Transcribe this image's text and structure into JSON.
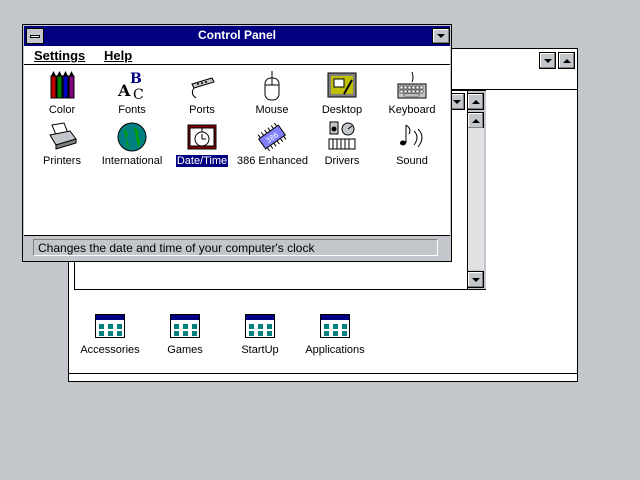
{
  "control_panel": {
    "title": "Control Panel",
    "menu": [
      {
        "label": "Settings"
      },
      {
        "label": "Help"
      }
    ],
    "icons": [
      {
        "label": "Color",
        "icon": "color-icon"
      },
      {
        "label": "Fonts",
        "icon": "fonts-icon"
      },
      {
        "label": "Ports",
        "icon": "ports-icon"
      },
      {
        "label": "Mouse",
        "icon": "mouse-icon"
      },
      {
        "label": "Desktop",
        "icon": "desktop-icon"
      },
      {
        "label": "Keyboard",
        "icon": "keyboard-icon"
      },
      {
        "label": "Printers",
        "icon": "printers-icon"
      },
      {
        "label": "International",
        "icon": "globe-icon"
      },
      {
        "label": "Date/Time",
        "icon": "date-time-icon",
        "selected": true
      },
      {
        "label": "386 Enhanced",
        "icon": "chip-icon"
      },
      {
        "label": "Drivers",
        "icon": "drivers-icon"
      },
      {
        "label": "Sound",
        "icon": "sound-icon"
      }
    ],
    "status": "Changes the date and time of your computer's clock"
  },
  "program_manager": {
    "groups": [
      {
        "label": "Accessories"
      },
      {
        "label": "Games"
      },
      {
        "label": "StartUp"
      },
      {
        "label": "Applications"
      }
    ]
  },
  "colors": {
    "titlebar": "#000080",
    "desktop": "#c3c7cb",
    "selection": "#000080"
  }
}
